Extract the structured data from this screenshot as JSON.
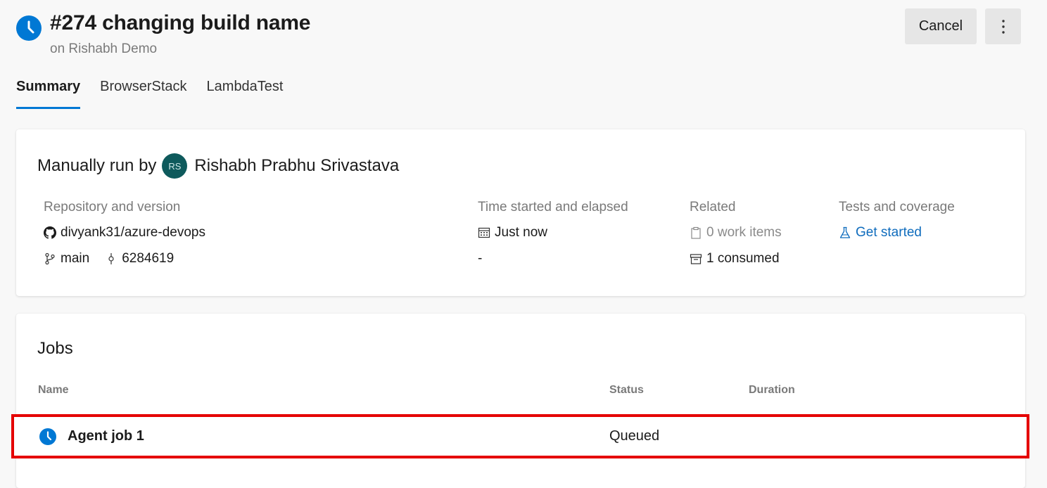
{
  "header": {
    "title": "#274 changing build name",
    "subtitle": "on Rishabh Demo",
    "cancel_label": "Cancel",
    "status_icon": "clock-icon",
    "more_icon": "more-vertical-icon"
  },
  "tabs": [
    {
      "label": "Summary",
      "active": true
    },
    {
      "label": "BrowserStack",
      "active": false
    },
    {
      "label": "LambdaTest",
      "active": false
    }
  ],
  "summary": {
    "run_by_label": "Manually run by",
    "avatar_initials": "RS",
    "user_name": "Rishabh Prabhu Srivastava",
    "repository": {
      "label": "Repository and version",
      "repo": "divyank31/azure-devops",
      "branch": "main",
      "commit": "6284619"
    },
    "time": {
      "label": "Time started and elapsed",
      "started": "Just now",
      "elapsed": "-"
    },
    "related": {
      "label": "Related",
      "work_items": "0 work items",
      "consumed": "1 consumed"
    },
    "tests": {
      "label": "Tests and coverage",
      "link": "Get started"
    }
  },
  "jobs": {
    "title": "Jobs",
    "columns": [
      "Name",
      "Status",
      "Duration"
    ],
    "rows": [
      {
        "name": "Agent job 1",
        "status": "Queued",
        "duration": ""
      }
    ]
  },
  "colors": {
    "accent": "#0078d4",
    "highlight_border": "#e50000",
    "avatar_bg": "#0e5a5c"
  }
}
